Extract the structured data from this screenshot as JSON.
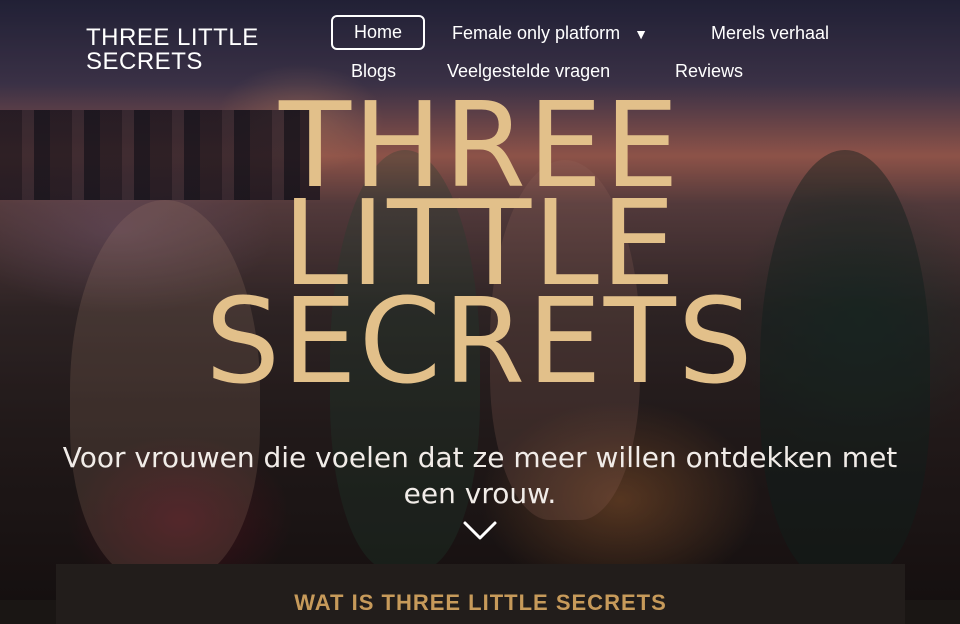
{
  "header": {
    "brand_line1": "THREE LITTLE",
    "brand_line2": "SECRETS"
  },
  "nav": {
    "home": "Home",
    "female_only": "Female only platform",
    "female_only_caret": "▼",
    "merels_verhaal": "Merels verhaal",
    "blogs": "Blogs",
    "faq": "Veelgestelde vragen",
    "reviews": "Reviews"
  },
  "hero": {
    "title_line1": "THREE",
    "title_line2": "LITTLE",
    "title_line3": "SECRETS",
    "tagline": "Voor vrouwen die voelen dat ze meer willen ontdekken met een vrouw.",
    "scroll_icon": "chevron-down-icon"
  },
  "section": {
    "title": "WAT IS THREE LITTLE SECRETS"
  },
  "colors": {
    "gold": "#e2c08a",
    "section_gold": "#c79a5a",
    "section_bg": "#221d1b"
  }
}
